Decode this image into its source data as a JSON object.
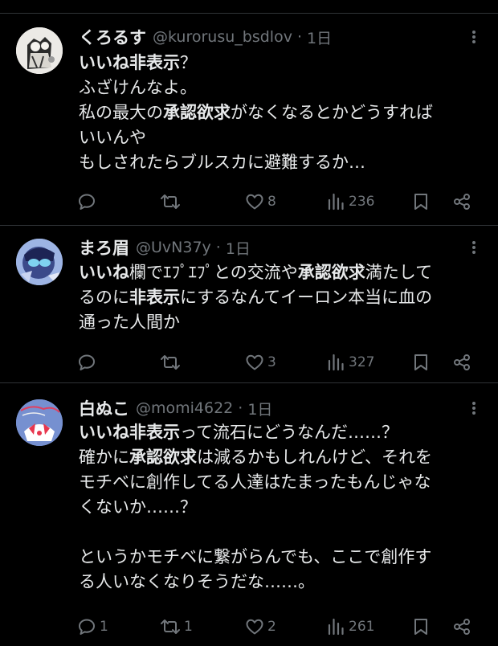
{
  "tweets": [
    {
      "name": "くろるす",
      "handle": "@kurorusu_bsdlov",
      "time": "1日",
      "avatar": "avatar-illustration",
      "lines": [
        [
          {
            "t": "いいね非表示",
            "b": true
          },
          {
            "t": "？",
            "b": false
          }
        ],
        [
          {
            "t": "ふざけんなよ。",
            "b": false
          }
        ],
        [
          {
            "t": "私の最大の",
            "b": false
          },
          {
            "t": "承認欲求",
            "b": true
          },
          {
            "t": "がなくなるとかどうすれば",
            "b": false
          }
        ],
        [
          {
            "t": "いいんや",
            "b": false
          }
        ],
        [
          {
            "t": "もしされたらブルスカに避難するか…",
            "b": false
          }
        ]
      ],
      "replies": "",
      "retweets": "",
      "likes": "8",
      "views": "236"
    },
    {
      "name": "まろ眉",
      "handle": "@UvN37y",
      "time": "1日",
      "avatar": "avatar-illustration",
      "lines": [
        [
          {
            "t": "いいね",
            "b": true
          },
          {
            "t": "欄でｴﾌﾟｴﾌﾟとの交流や",
            "b": false
          },
          {
            "t": "承認欲求",
            "b": true
          },
          {
            "t": "満たして",
            "b": false
          }
        ],
        [
          {
            "t": "るのに",
            "b": false
          },
          {
            "t": "非表示",
            "b": true
          },
          {
            "t": "にするなんてイーロン本当に血の",
            "b": false
          }
        ],
        [
          {
            "t": "通った人間か",
            "b": false
          }
        ]
      ],
      "replies": "",
      "retweets": "",
      "likes": "3",
      "views": "327"
    },
    {
      "name": "白ぬこ",
      "handle": "@momi4622",
      "time": "1日",
      "avatar": "avatar-illustration",
      "lines": [
        [
          {
            "t": "いいね非表示",
            "b": true
          },
          {
            "t": "って流石にどうなんだ……？",
            "b": false
          }
        ],
        [
          {
            "t": "確かに",
            "b": false
          },
          {
            "t": "承認欲求",
            "b": true
          },
          {
            "t": "は減るかもしれんけど、それを",
            "b": false
          }
        ],
        [
          {
            "t": "モチベに創作してる人達はたまったもんじゃな",
            "b": false
          }
        ],
        [
          {
            "t": "くないか……？",
            "b": false
          }
        ],
        [
          {
            "t": "",
            "b": false
          }
        ],
        [
          {
            "t": "というかモチベに繋がらんでも、ここで創作す",
            "b": false
          }
        ],
        [
          {
            "t": "る人いなくなりそうだな……。",
            "b": false
          }
        ]
      ],
      "replies": "1",
      "retweets": "1",
      "likes": "2",
      "views": "261"
    }
  ],
  "colors": {
    "background": "#000000",
    "text": "#e7e9ea",
    "secondary": "#71767b",
    "divider": "#2f3336"
  }
}
